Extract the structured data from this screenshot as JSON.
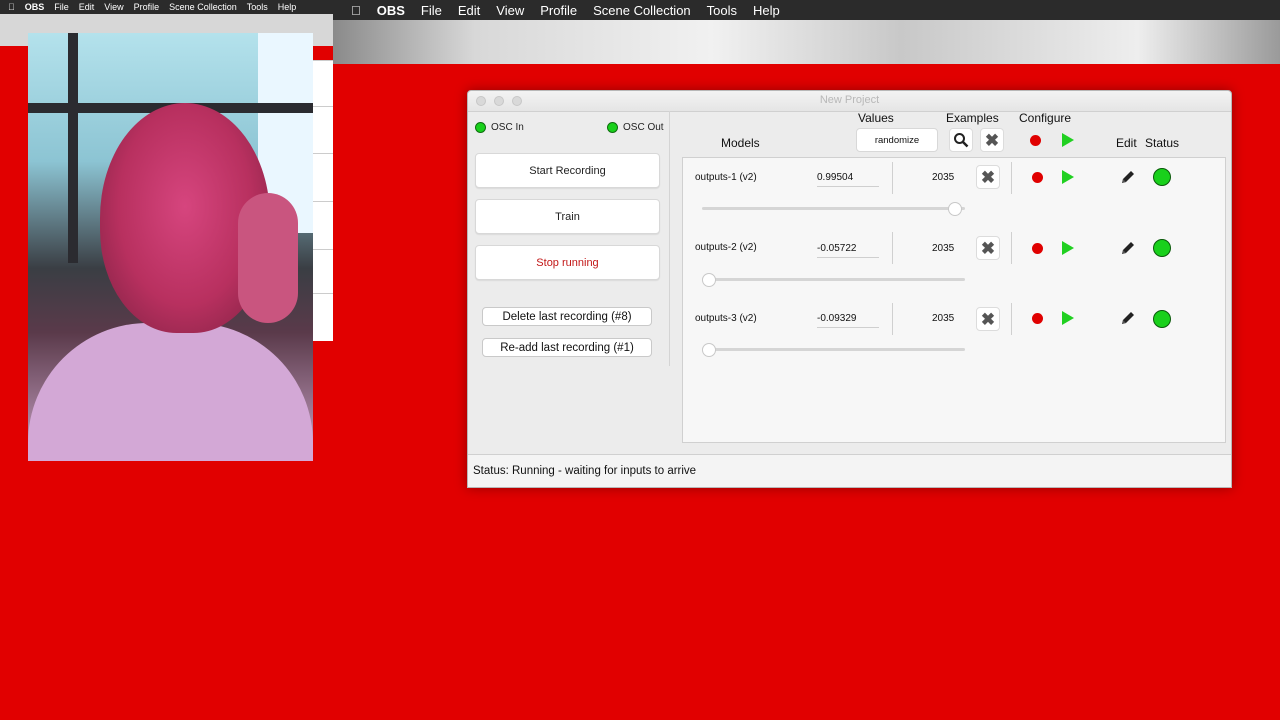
{
  "menubar_small": {
    "app": "OBS",
    "items": [
      "File",
      "Edit",
      "View",
      "Profile",
      "Scene Collection",
      "Tools",
      "Help"
    ]
  },
  "menubar_big": {
    "app": "OBS",
    "items": [
      "File",
      "Edit",
      "View",
      "Profile",
      "Scene Collection",
      "Tools",
      "Help"
    ]
  },
  "window": {
    "title": "New Project",
    "osc_in": "OSC In",
    "osc_out": "OSC Out",
    "start_recording": "Start Recording",
    "train": "Train",
    "stop_running": "Stop running",
    "delete_last": "Delete last recording (#8)",
    "readd_last": "Re-add last recording (#1)",
    "headers": {
      "models": "Models",
      "values": "Values",
      "examples": "Examples",
      "configure": "Configure",
      "edit": "Edit",
      "status": "Status"
    },
    "randomize": "randomize",
    "rows": [
      {
        "name": "outputs-1 (v2)",
        "value": "0.99504",
        "examples": "2035",
        "slider": 0.98
      },
      {
        "name": "outputs-2 (v2)",
        "value": "-0.05722",
        "examples": "2035",
        "slider": 0.0
      },
      {
        "name": "outputs-3 (v2)",
        "value": "-0.09329",
        "examples": "2035",
        "slider": 0.0
      }
    ],
    "status_text": "Status:  Running - waiting for inputs to arrive"
  },
  "colors": {
    "background": "#e10000",
    "green_status": "#19d01b",
    "record_red": "#e00000"
  }
}
